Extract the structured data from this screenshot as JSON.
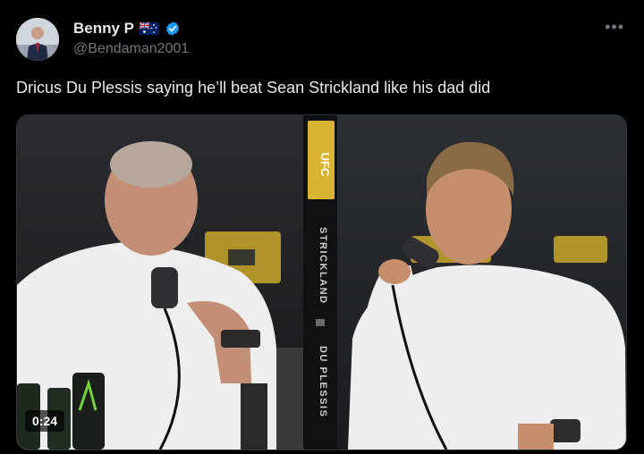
{
  "tweet": {
    "author": {
      "display_name": "Benny P",
      "handle": "@Bendaman2001",
      "flag": "australia-flag",
      "verified": true
    },
    "more_label": "•••",
    "text": "Dricus Du Plessis saying he’ll beat Sean Strickland like his dad did",
    "media": {
      "type": "video",
      "timestamp": "0:24",
      "banner_text": "STRICKLAND",
      "banner_text_2": "DU PLESSIS",
      "logo_text": "UFC"
    }
  },
  "colors": {
    "background": "#000000",
    "text_primary": "#e7e9ea",
    "text_secondary": "#71767b",
    "verified_blue": "#1d9bf0",
    "ufc_gold": "#d9b432"
  }
}
